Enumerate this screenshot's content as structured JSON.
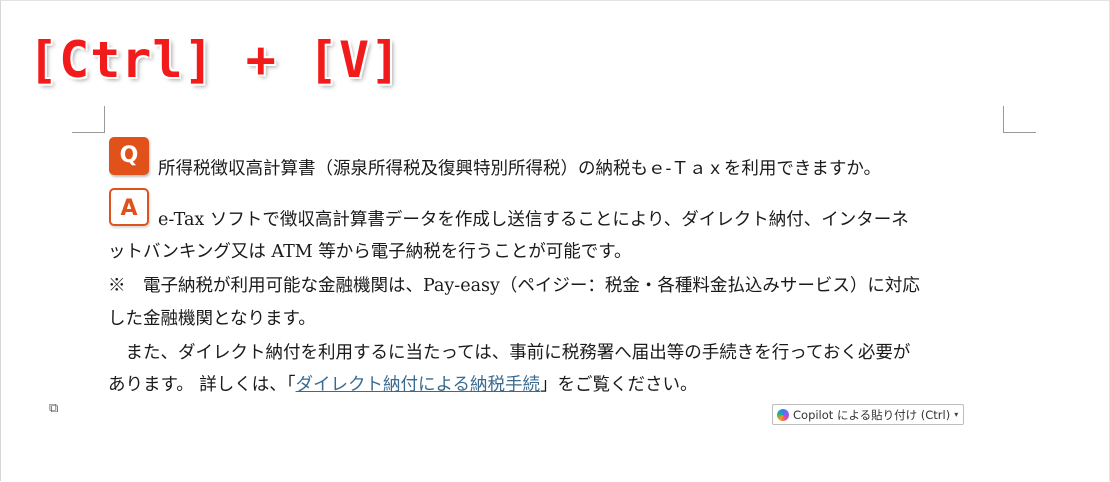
{
  "banner": {
    "shortcut_text": "[Ctrl] + [V]"
  },
  "icons": {
    "question_letter": "Q",
    "answer_letter": "A"
  },
  "document": {
    "question": "所得税徴収高計算書（源泉所得税及復興特別所得税）の納税もｅ‐Ｔａｘを利用できますか。",
    "answer_line1": "e-Tax ソフトで徴収高計算書データを作成し送信することにより、ダイレクト納付、インターネ",
    "answer_line2": "ットバンキング又は ATM 等から電子納税を行うことが可能です。",
    "note_line1": "※　電子納税が利用可能な金融機関は、Pay-easy（ペイジー：税金・各種料金払込みサービス）に対応",
    "note_line2": "した金融機関となります。",
    "para_line1": "　また、ダイレクト納付を利用するに当たっては、事前に税務署へ届出等の手続きを行っておく必要が",
    "para_line2_prefix": "あります。 詳しくは、「",
    "para_line2_link": "ダイレクト納付による納税手続",
    "para_line2_suffix": "」をご覧ください。"
  },
  "paste_options": {
    "copilot_label": "Copilot による貼り付け (Ctrl)"
  },
  "colors": {
    "banner_red": "#f21b1b",
    "qa_orange": "#e0521a",
    "link_blue": "#3a6b8f"
  }
}
